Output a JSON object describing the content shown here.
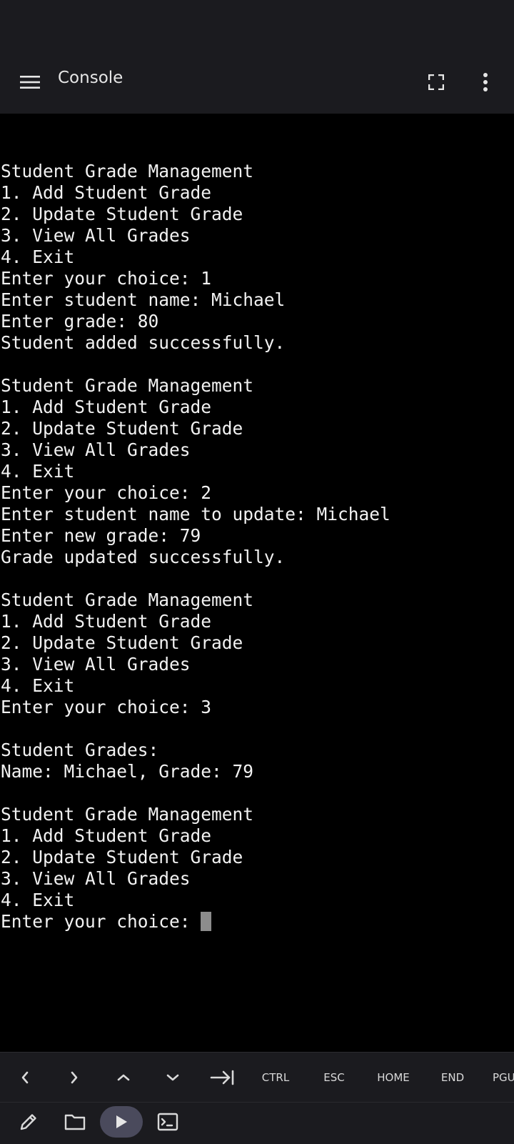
{
  "app_bar": {
    "title": "Console",
    "menu_icon": "hamburger-menu-icon",
    "fullscreen_icon": "fullscreen-icon",
    "more_icon": "more-vert-icon"
  },
  "console": {
    "lines": [
      "",
      "Student Grade Management",
      "1. Add Student Grade",
      "2. Update Student Grade",
      "3. View All Grades",
      "4. Exit",
      "Enter your choice: 1",
      "Enter student name: Michael",
      "Enter grade: 80",
      "Student added successfully.",
      "",
      "Student Grade Management",
      "1. Add Student Grade",
      "2. Update Student Grade",
      "3. View All Grades",
      "4. Exit",
      "Enter your choice: 2",
      "Enter student name to update: Michael",
      "Enter new grade: 79",
      "Grade updated successfully.",
      "",
      "Student Grade Management",
      "1. Add Student Grade",
      "2. Update Student Grade",
      "3. View All Grades",
      "4. Exit",
      "Enter your choice: 3",
      "",
      "Student Grades:",
      "Name: Michael, Grade: 79",
      "",
      "Student Grade Management",
      "1. Add Student Grade",
      "2. Update Student Grade",
      "3. View All Grades",
      "4. Exit"
    ],
    "prompt": "Enter your choice: ",
    "colors": {
      "background": "#000000",
      "text": "#f2f2f2",
      "cursor": "#8c8c8c"
    }
  },
  "extra_keys": {
    "left_icon": "chevron-left-icon",
    "right_icon": "chevron-right-icon",
    "up_icon": "chevron-up-icon",
    "down_icon": "chevron-down-icon",
    "tab_icon": "tab-arrow-icon",
    "ctrl": "CTRL",
    "esc": "ESC",
    "home": "HOME",
    "end": "END",
    "pgup": "PGUP"
  },
  "bottom_bar": {
    "edit_icon": "pencil-icon",
    "folder_icon": "folder-icon",
    "run_icon": "play-icon",
    "terminal_icon": "terminal-icon",
    "accent": "#4a4a5c"
  }
}
